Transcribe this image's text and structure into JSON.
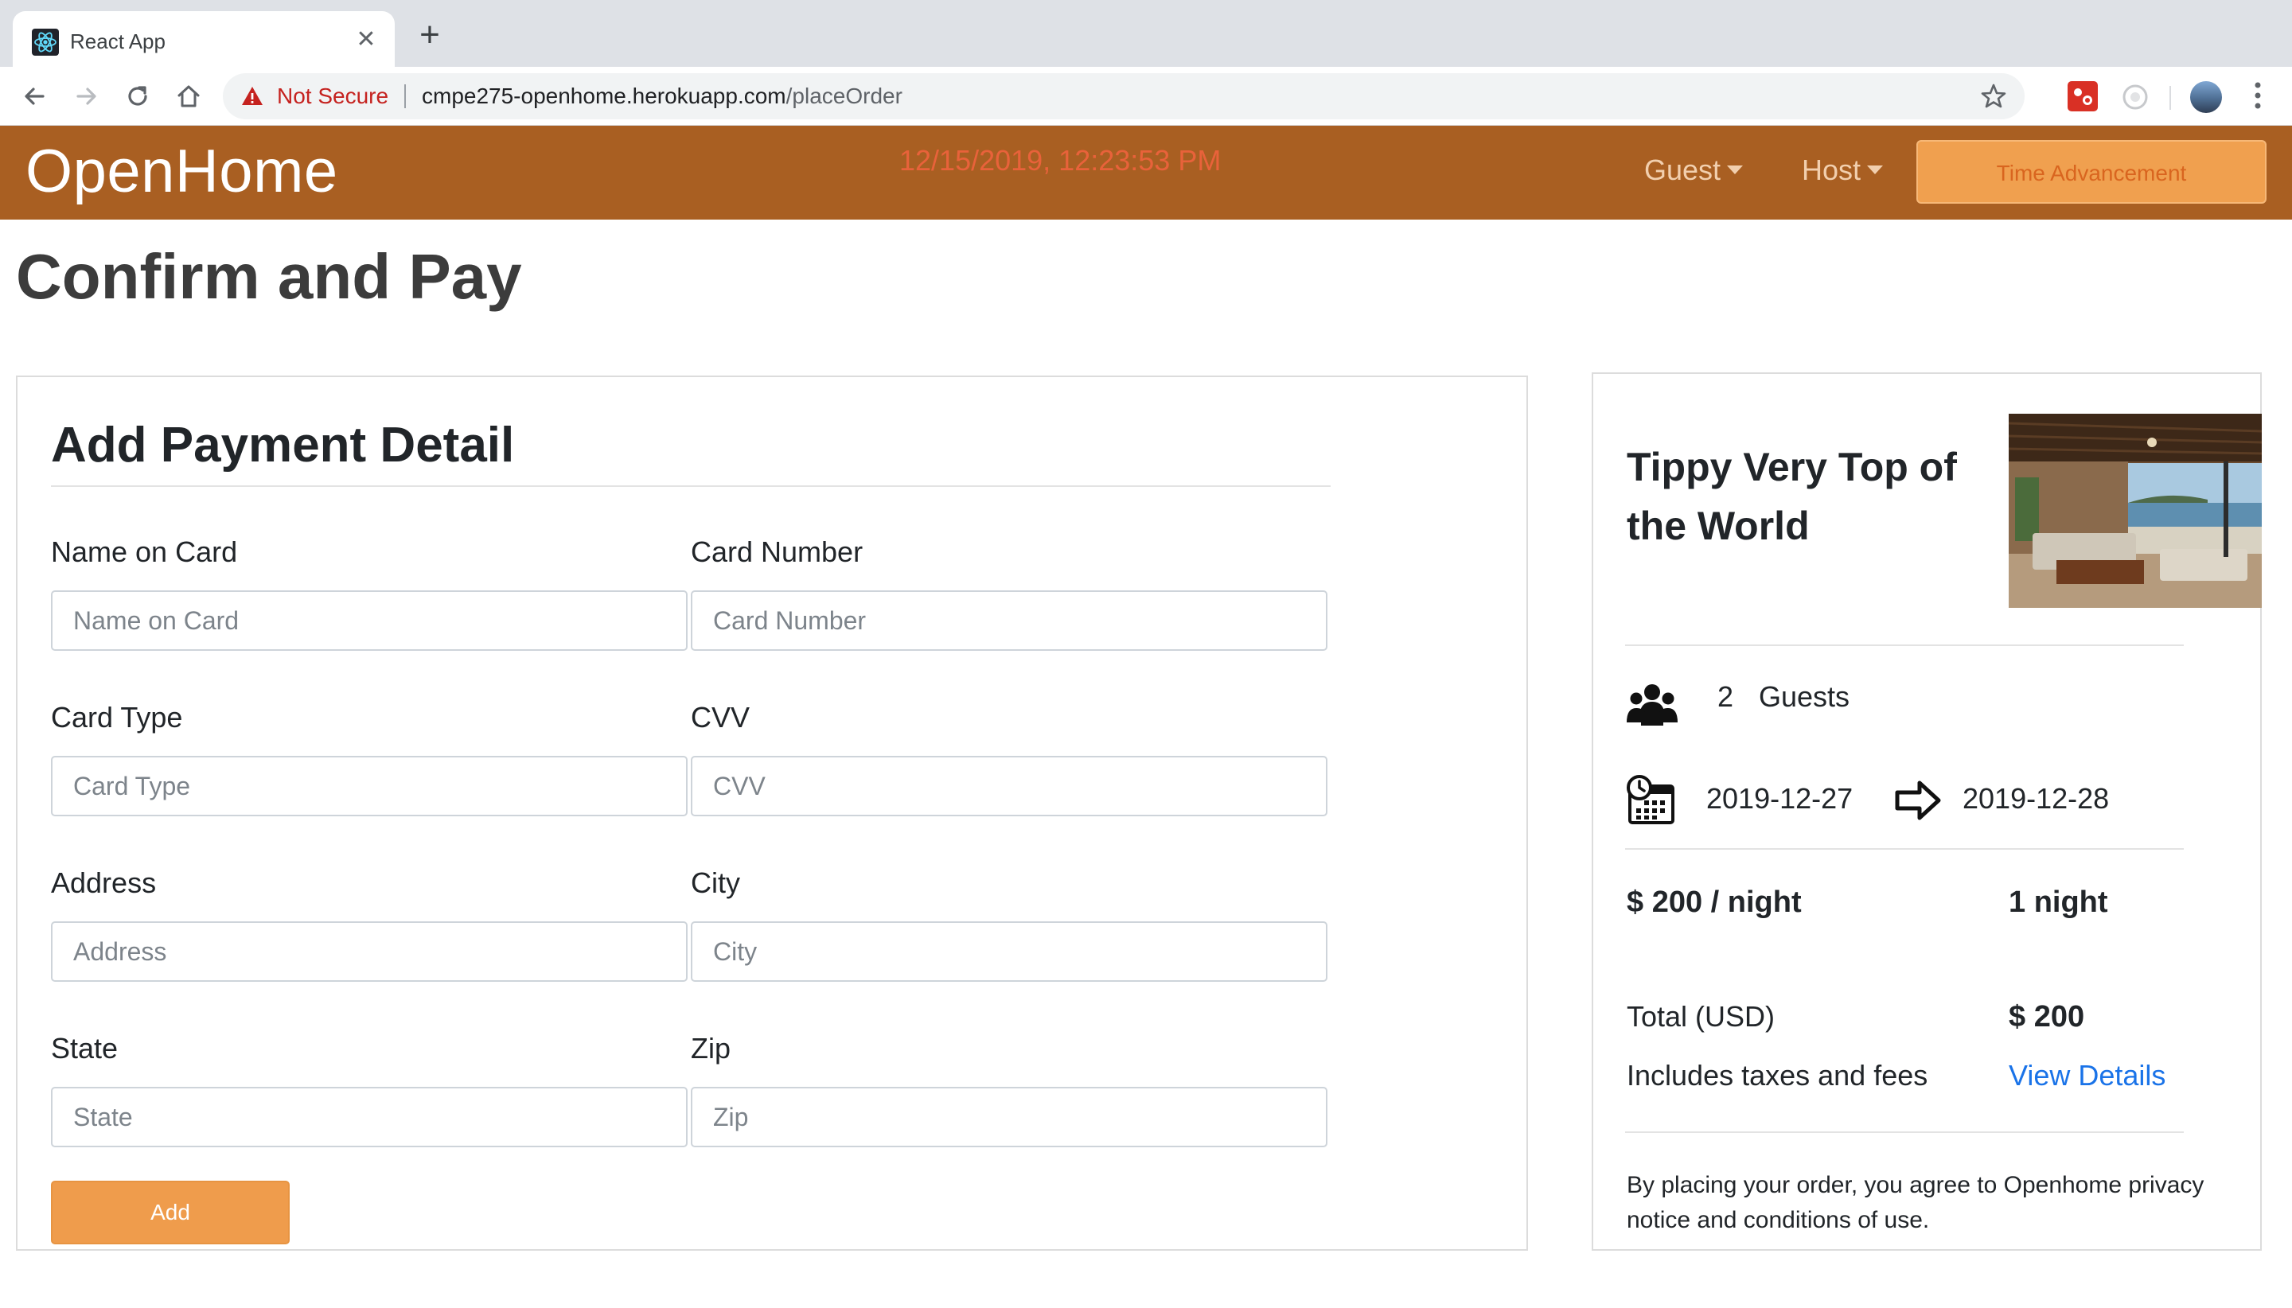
{
  "browser": {
    "tab_title": "React App",
    "security_label": "Not Secure",
    "url_host": "cmpe275-openhome.herokuapp.com",
    "url_path": "/placeOrder"
  },
  "navbar": {
    "brand": "OpenHome",
    "clock": "12/15/2019, 12:23:53 PM",
    "guest_menu": "Guest",
    "host_menu": "Host",
    "time_button": "Time Advancement",
    "colors": {
      "bar": "#a95f22",
      "button": "#f0a04f",
      "clock": "#e8623a"
    }
  },
  "page": {
    "title": "Confirm and Pay"
  },
  "payment_form": {
    "title": "Add Payment Detail",
    "fields": [
      {
        "label": "Name on Card",
        "placeholder": "Name on Card",
        "value": ""
      },
      {
        "label": "Card Number",
        "placeholder": "Card Number",
        "value": ""
      },
      {
        "label": "Card Type",
        "placeholder": "Card Type",
        "value": ""
      },
      {
        "label": "CVV",
        "placeholder": "CVV",
        "value": ""
      },
      {
        "label": "Address",
        "placeholder": "Address",
        "value": ""
      },
      {
        "label": "City",
        "placeholder": "City",
        "value": ""
      },
      {
        "label": "State",
        "placeholder": "State",
        "value": ""
      },
      {
        "label": "Zip",
        "placeholder": "Zip",
        "value": ""
      }
    ],
    "submit_label": "Add"
  },
  "summary": {
    "property_name": "Tippy Very Top of the World",
    "guest_count": "2",
    "guests_label": "Guests",
    "check_in": "2019-12-27",
    "check_out": "2019-12-28",
    "rate": "$ 200 / night",
    "nights": "1 night",
    "total_label": "Total (USD)",
    "total_value": "$ 200",
    "taxes_note": "Includes taxes and fees",
    "details_link": "View Details",
    "legal": "By placing your order, you agree to Openhome privacy notice and conditions of use.",
    "icons": [
      "users-icon",
      "calendar-clock-icon",
      "arrow-right-icon"
    ]
  }
}
